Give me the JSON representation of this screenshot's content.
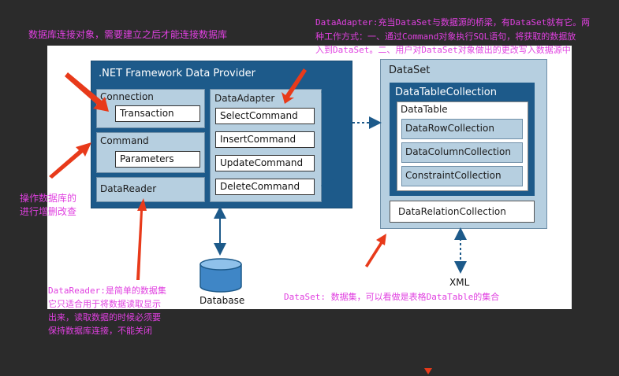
{
  "annotations": {
    "connection_note": "数据库连接对象，需要建立之后才能连接数据库",
    "adapter_note_line1": "DataAdapter:充当DataSet与数据源的桥梁，有DataSet就有它。两",
    "adapter_note_line2": "种工作方式：一、通过Command对象执行SQL语句，将获取的数据放",
    "adapter_note_line3": "入到DataSet。二、用户对DataSet对象做出的更改写入数据源中",
    "command_note_line1": "操作数据库的",
    "command_note_line2": "进行增删改查",
    "reader_note_line1": "DataReader:是简单的数据集",
    "reader_note_line2": "它只适合用于将数据读取显示",
    "reader_note_line3": "出来，读取数据的时候必须要",
    "reader_note_line4": "保持数据库连接，不能关闭",
    "dataset_note": "DataSet: 数据集，可以看做是表格DataTable的集合"
  },
  "provider": {
    "title": ".NET Framework Data Provider",
    "connection": "Connection",
    "transaction": "Transaction",
    "command": "Command",
    "parameters": "Parameters",
    "datareader": "DataReader",
    "dataadapter": "DataAdapter",
    "select": "SelectCommand",
    "insert": "InsertCommand",
    "update": "UpdateCommand",
    "delete": "DeleteCommand"
  },
  "dataset": {
    "title": "DataSet",
    "table_collection": "DataTableCollection",
    "datatable": "DataTable",
    "row_collection": "DataRowCollection",
    "column_collection": "DataColumnCollection",
    "constraint_collection": "ConstraintCollection",
    "relation_collection": "DataRelationCollection"
  },
  "database": "Database",
  "xml": "XML",
  "colors": {
    "annotation": "#e040e0",
    "arrow": "#e83a1a",
    "dark_blue": "#1d5a8a",
    "light_blue": "#b6cfe0",
    "background": "#2b2b2b"
  }
}
